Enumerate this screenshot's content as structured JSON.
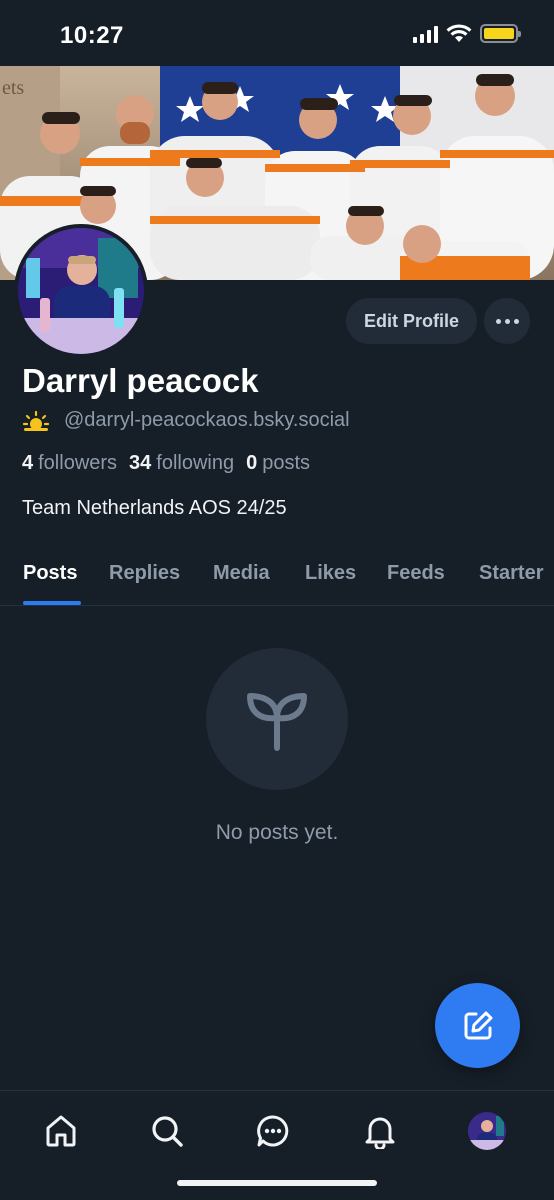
{
  "status_bar": {
    "time": "10:27",
    "battery_color": "#f6d51c"
  },
  "profile": {
    "display_name": "Darryl peacock",
    "handle_emoji": "🌥️",
    "handle": "@darryl-peacockaos.bsky.social",
    "followers_count": "4",
    "followers_label": "followers",
    "following_count": "34",
    "following_label": "following",
    "posts_count": "0",
    "posts_label": "posts",
    "bio": "Team Netherlands AOS 24/25",
    "banner_text": "ets"
  },
  "actions": {
    "edit_profile_label": "Edit Profile",
    "more_icon": "ellipsis-icon"
  },
  "tabs": [
    {
      "label": "Posts",
      "active": true
    },
    {
      "label": "Replies",
      "active": false
    },
    {
      "label": "Media",
      "active": false
    },
    {
      "label": "Likes",
      "active": false
    },
    {
      "label": "Feeds",
      "active": false
    },
    {
      "label": "Starter",
      "active": false
    }
  ],
  "empty_state": {
    "icon": "sprout-icon",
    "message": "No posts yet."
  },
  "fab": {
    "icon": "compose-icon",
    "color": "#2e7bf2"
  },
  "bottom_nav": [
    {
      "icon": "home-icon"
    },
    {
      "icon": "search-icon"
    },
    {
      "icon": "chat-icon"
    },
    {
      "icon": "bell-icon"
    },
    {
      "icon": "profile-avatar"
    }
  ],
  "colors": {
    "background": "#161e27",
    "accent": "#2b7cf0",
    "muted_text": "#8e9baa",
    "button_bg": "#222c38"
  }
}
